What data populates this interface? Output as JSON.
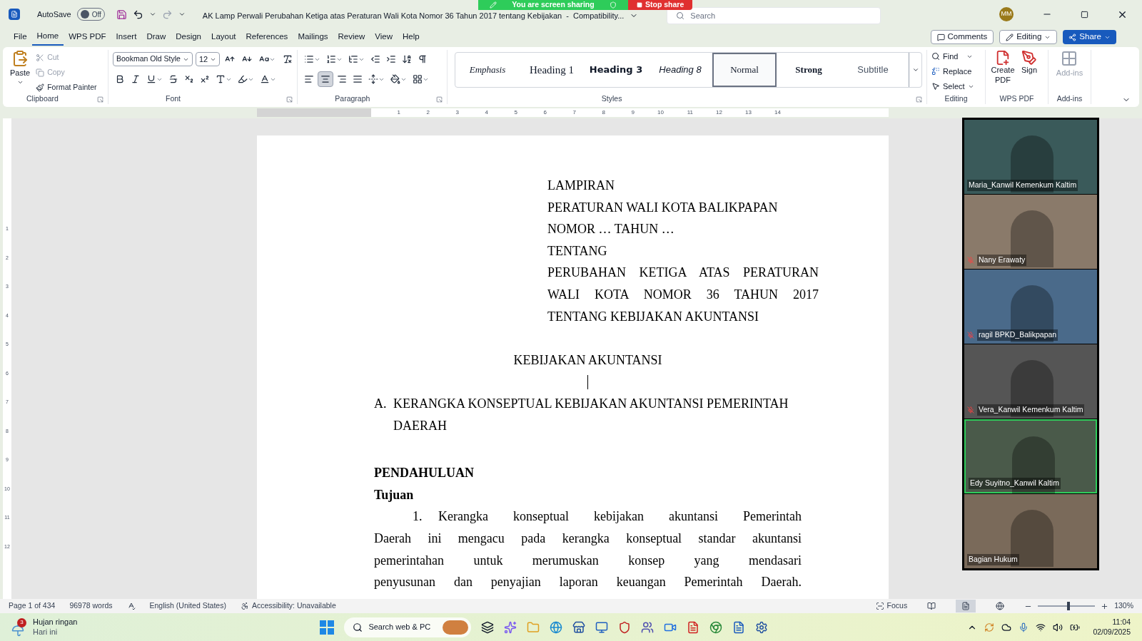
{
  "title_bar": {
    "autosave_label": "AutoSave",
    "autosave": {
      "on": false,
      "label": "Off"
    },
    "document_title": "AK Lamp Perwali Perubahan Ketiga atas Peraturan Wali Kota Nomor 36 Tahun 2017 tentang Kebijakan  -  Compatibility...",
    "search_placeholder": "Search",
    "avatar": "MM"
  },
  "share_banner": {
    "status": "You are screen sharing",
    "stop": "Stop share"
  },
  "menu_tabs": [
    {
      "label": "File",
      "selected": false
    },
    {
      "label": "Home",
      "selected": true
    },
    {
      "label": "WPS PDF",
      "selected": false
    },
    {
      "label": "Insert",
      "selected": false
    },
    {
      "label": "Draw",
      "selected": false
    },
    {
      "label": "Design",
      "selected": false
    },
    {
      "label": "Layout",
      "selected": false
    },
    {
      "label": "References",
      "selected": false
    },
    {
      "label": "Mailings",
      "selected": false
    },
    {
      "label": "Review",
      "selected": false
    },
    {
      "label": "View",
      "selected": false
    },
    {
      "label": "Help",
      "selected": false
    }
  ],
  "actions": {
    "comments": "Comments",
    "editing": "Editing",
    "share": "Share"
  },
  "clipboard": {
    "paste": "Paste",
    "cut": {
      "label": "Cut",
      "disabled": true
    },
    "copy": {
      "label": "Copy",
      "disabled": true
    },
    "format_painter": {
      "label": "Format Painter",
      "disabled": false
    },
    "group": "Clipboard"
  },
  "font": {
    "name": "Bookman Old Style",
    "size": "12",
    "group": "Font"
  },
  "paragraph": {
    "group": "Paragraph",
    "align": [
      {
        "selected": false
      },
      {
        "selected": true
      },
      {
        "selected": false
      },
      {
        "selected": false
      }
    ]
  },
  "styles": {
    "group": "Styles",
    "items": [
      {
        "label": "Emphasis",
        "kind": "emphasis",
        "selected": false
      },
      {
        "label": "Heading 1",
        "kind": "heading1",
        "selected": false
      },
      {
        "label": "Heading 3",
        "kind": "heading3",
        "selected": false
      },
      {
        "label": "Heading 8",
        "kind": "heading8",
        "selected": false
      },
      {
        "label": "Normal",
        "kind": "normal",
        "selected": true
      },
      {
        "label": "Strong",
        "kind": "strong",
        "selected": false
      },
      {
        "label": "Subtitle",
        "kind": "subtitle",
        "selected": false
      }
    ]
  },
  "editing": {
    "group": "Editing",
    "find": "Find",
    "replace": "Replace",
    "select": "Select"
  },
  "wps_pdf": {
    "group": "WPS PDF",
    "create": "Create PDF",
    "sign": "Sign"
  },
  "addins": {
    "group": "Add-ins",
    "button": {
      "label": "Add-ins",
      "disabled": true
    }
  },
  "ruler": [
    "1",
    "2",
    "3",
    "4",
    "5",
    "6",
    "7",
    "8",
    "9",
    "10",
    "11",
    "12",
    "13",
    "14"
  ],
  "vertical_ruler": [
    "1",
    "2",
    "3",
    "4",
    "5",
    "6",
    "7",
    "8",
    "9",
    "10",
    "11",
    "12"
  ],
  "document": {
    "header_lines": [
      {
        "text": "LAMPIRAN"
      },
      {
        "text": "PERATURAN WALI KOTA BALIKPAPAN",
        "justify": false
      },
      {
        "text": "NOMOR … TAHUN …",
        "justify": false
      },
      {
        "text": "TENTANG"
      },
      {
        "text": "PERUBAHAN KETIGA ATAS PERATURAN",
        "justify": true
      },
      {
        "text": "WALI KOTA NOMOR 36 TAHUN 2017",
        "justify": true
      },
      {
        "text": "TENTANG KEBIJAKAN AKUNTANSI",
        "justify": false
      }
    ],
    "title": "KEBIJAKAN AKUNTANSI",
    "section": {
      "marker": "A.",
      "lines": [
        "KERANGKA KONSEPTUAL KEBIJAKAN AKUNTANSI PEMERINTAH",
        "DAERAH"
      ]
    },
    "headings": [
      "PENDAHULUAN",
      "Tujuan"
    ],
    "body_lines": [
      {
        "kind": "first",
        "marker": "1.",
        "text": "Kerangka konseptual kebijakan akuntansi Pemerintah"
      },
      {
        "kind": "line",
        "text": "Daerah ini mengacu pada kerangka konseptual standar akuntansi"
      },
      {
        "kind": "line",
        "text": "pemerintahan untuk merumuskan konsep yang mendasari"
      },
      {
        "kind": "line",
        "text": "penyusunan dan penyajian laporan keuangan Pemerintah Daerah."
      }
    ]
  },
  "participants": [
    {
      "name": "Maria_Kanwil Kemenkum Kaltim",
      "muted": false,
      "speaking": false
    },
    {
      "name": "Nany Erawaty",
      "muted": true,
      "speaking": false
    },
    {
      "name": "ragil BPKD_Balikpapan",
      "muted": true,
      "speaking": false
    },
    {
      "name": "Vera_Kanwil Kemenkum Kaltim",
      "muted": true,
      "speaking": false
    },
    {
      "name": "Edy Suyitno_Kanwil Kaltim",
      "muted": false,
      "speaking": true
    },
    {
      "name": "Bagian Hukum",
      "muted": false,
      "speaking": false
    }
  ],
  "status_bar": {
    "page": "Page 1 of 434",
    "words": "96978 words",
    "language": "English (United States)",
    "accessibility": "Accessibility: Unavailable",
    "focus": "Focus",
    "views": [
      {
        "selected": false
      },
      {
        "selected": true
      },
      {
        "selected": false
      }
    ],
    "zoom": {
      "level": 0.54,
      "label": "130%"
    }
  },
  "taskbar": {
    "weather": {
      "badge": "3",
      "title": "Hujan ringan",
      "subtitle": "Hari ini"
    },
    "search": "Search web & PC",
    "time": "11:04",
    "date": "02/09/2025"
  }
}
